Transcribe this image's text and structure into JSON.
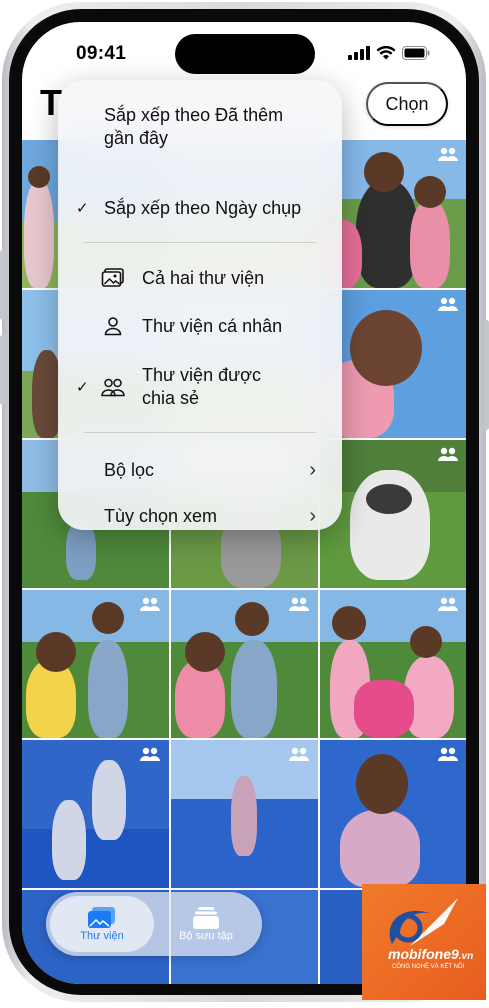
{
  "status_bar": {
    "time": "09:41"
  },
  "header": {
    "title": "T",
    "select_label": "Chọn"
  },
  "menu": {
    "sort_items": [
      {
        "label": "Sắp xếp theo Đã thêm gần đây",
        "checked": false
      },
      {
        "label": "Sắp xếp theo Ngày chụp",
        "checked": true
      }
    ],
    "library_items": [
      {
        "label": "Cả hai thư viện",
        "icon": "photos-stack-icon",
        "checked": false
      },
      {
        "label": "Thư viện cá nhân",
        "icon": "person-icon",
        "checked": false
      },
      {
        "label": "Thư viện được chia sẻ",
        "icon": "people-icon",
        "checked": true
      }
    ],
    "nav_items": [
      {
        "label": "Bộ lọc",
        "icon": "chevron-right-icon"
      },
      {
        "label": "Tùy chọn xem",
        "icon": "chevron-right-icon"
      }
    ]
  },
  "tab_bar": {
    "tabs": [
      {
        "label": "Thư viện",
        "icon": "photo-library-icon",
        "active": true
      },
      {
        "label": "Bộ sưu tập",
        "icon": "collections-icon",
        "active": false
      }
    ]
  },
  "watermark": {
    "brand": "mobifone9",
    "domain": ".vn",
    "tagline": "CÔNG NGHỆ VÀ KẾT NỐI"
  },
  "colors": {
    "accent": "#1a7cf5",
    "watermark": "#ef6a23"
  }
}
